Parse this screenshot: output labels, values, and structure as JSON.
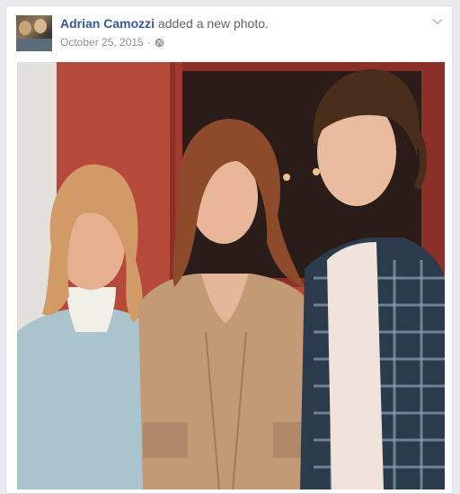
{
  "post": {
    "author": "Adrian Camozzi",
    "action": "added a new photo.",
    "date": "October 25, 2015",
    "separator": "·",
    "privacy_icon": "globe-icon",
    "menu_icon": "chevron-down-icon"
  },
  "colors": {
    "link": "#365899",
    "meta": "#90949c",
    "background": "#e9ebee"
  }
}
